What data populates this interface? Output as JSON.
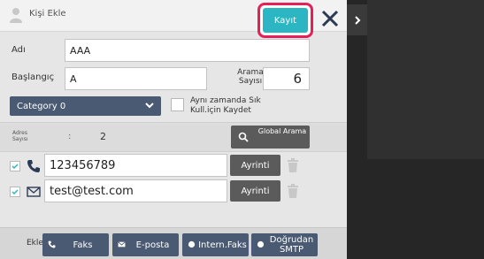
{
  "header": {
    "title": "Kişi Ekle",
    "save_label": "Kayıt"
  },
  "form": {
    "name_label": "Adı",
    "name_value": "AAA",
    "initial_label": "Başlangıç",
    "initial_value": "A",
    "search_count_label": "Arama Sayısı",
    "search_count_value": "6",
    "category_value": "Category 0",
    "save_for_frequent_label": "Aynı zamanda Sık Kull.için Kaydet"
  },
  "address_bar": {
    "count_label": "Adres Sayısı",
    "colon": ":",
    "count_value": "2",
    "global_search_label": "Global Arama"
  },
  "addresses": [
    {
      "type": "phone-icon",
      "value": "123456789",
      "detail_label": "Ayrinti"
    },
    {
      "type": "envelope-icon",
      "value": "test@test.com",
      "detail_label": "Ayrinti"
    }
  ],
  "bottom": {
    "add_label": "Ekle",
    "buttons": [
      {
        "label": "Faks",
        "icon": "phone-icon"
      },
      {
        "label": "E-posta",
        "icon": "envelope-icon"
      },
      {
        "label": "Intern.Faks",
        "icon": "globe-icon"
      },
      {
        "label": "Doğrudan SMTP",
        "icon": "globe-icon"
      }
    ]
  },
  "colors": {
    "save_button": "#2cb5c3",
    "highlight_border": "#e61e5a",
    "category_button": "#4a5a72",
    "dark_button": "#5b5b5b"
  }
}
